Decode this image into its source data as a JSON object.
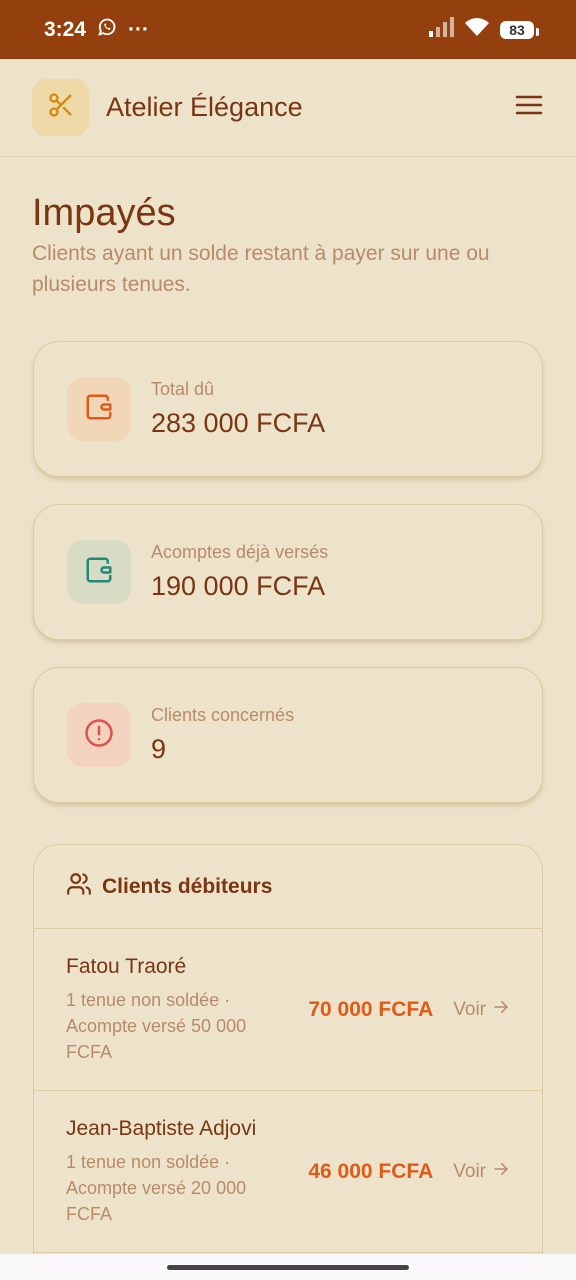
{
  "status_bar": {
    "time": "3:24",
    "more": "···",
    "battery": "83",
    "icons": [
      "whatsapp-icon",
      "more-icon",
      "signal-icon",
      "wifi-icon",
      "battery-icon"
    ]
  },
  "header": {
    "app_name": "Atelier Élégance",
    "logo_icon": "scissors-icon",
    "menu_icon": "menu-icon"
  },
  "page": {
    "title": "Impayés",
    "subtitle": "Clients ayant un solde restant à payer sur une ou plusieurs tenues."
  },
  "stats": [
    {
      "label": "Total dû",
      "value": "283 000 FCFA",
      "icon": "wallet-icon",
      "accent": "#E25A17",
      "icon_bg": "#F1D7B8"
    },
    {
      "label": "Acomptes déjà versés",
      "value": "190 000 FCFA",
      "icon": "wallet-icon",
      "accent": "#1F8A78",
      "icon_bg": "#D9DCC5"
    },
    {
      "label": "Clients concernés",
      "value": "9",
      "icon": "alert-circle-icon",
      "accent": "#E2504A",
      "icon_bg": "#F1D3C0"
    }
  ],
  "debtors": {
    "title": "Clients débiteurs",
    "icon": "users-icon",
    "rows": [
      {
        "name": "Fatou Traoré",
        "detail": "1 tenue non soldée · Acompte versé 50 000 FCFA",
        "amount": "70 000 FCFA",
        "action": "Voir"
      },
      {
        "name": "Jean-Baptiste Adjovi",
        "detail": "1 tenue non soldée · Acompte versé 20 000 FCFA",
        "amount": "46 000 FCFA",
        "action": "Voir"
      }
    ]
  },
  "colors": {
    "status_bar": "#93400E",
    "background": "#EDE3CB",
    "primary_text": "#7A3511",
    "muted_text": "#B98A6A",
    "amount": "#E25A17"
  }
}
